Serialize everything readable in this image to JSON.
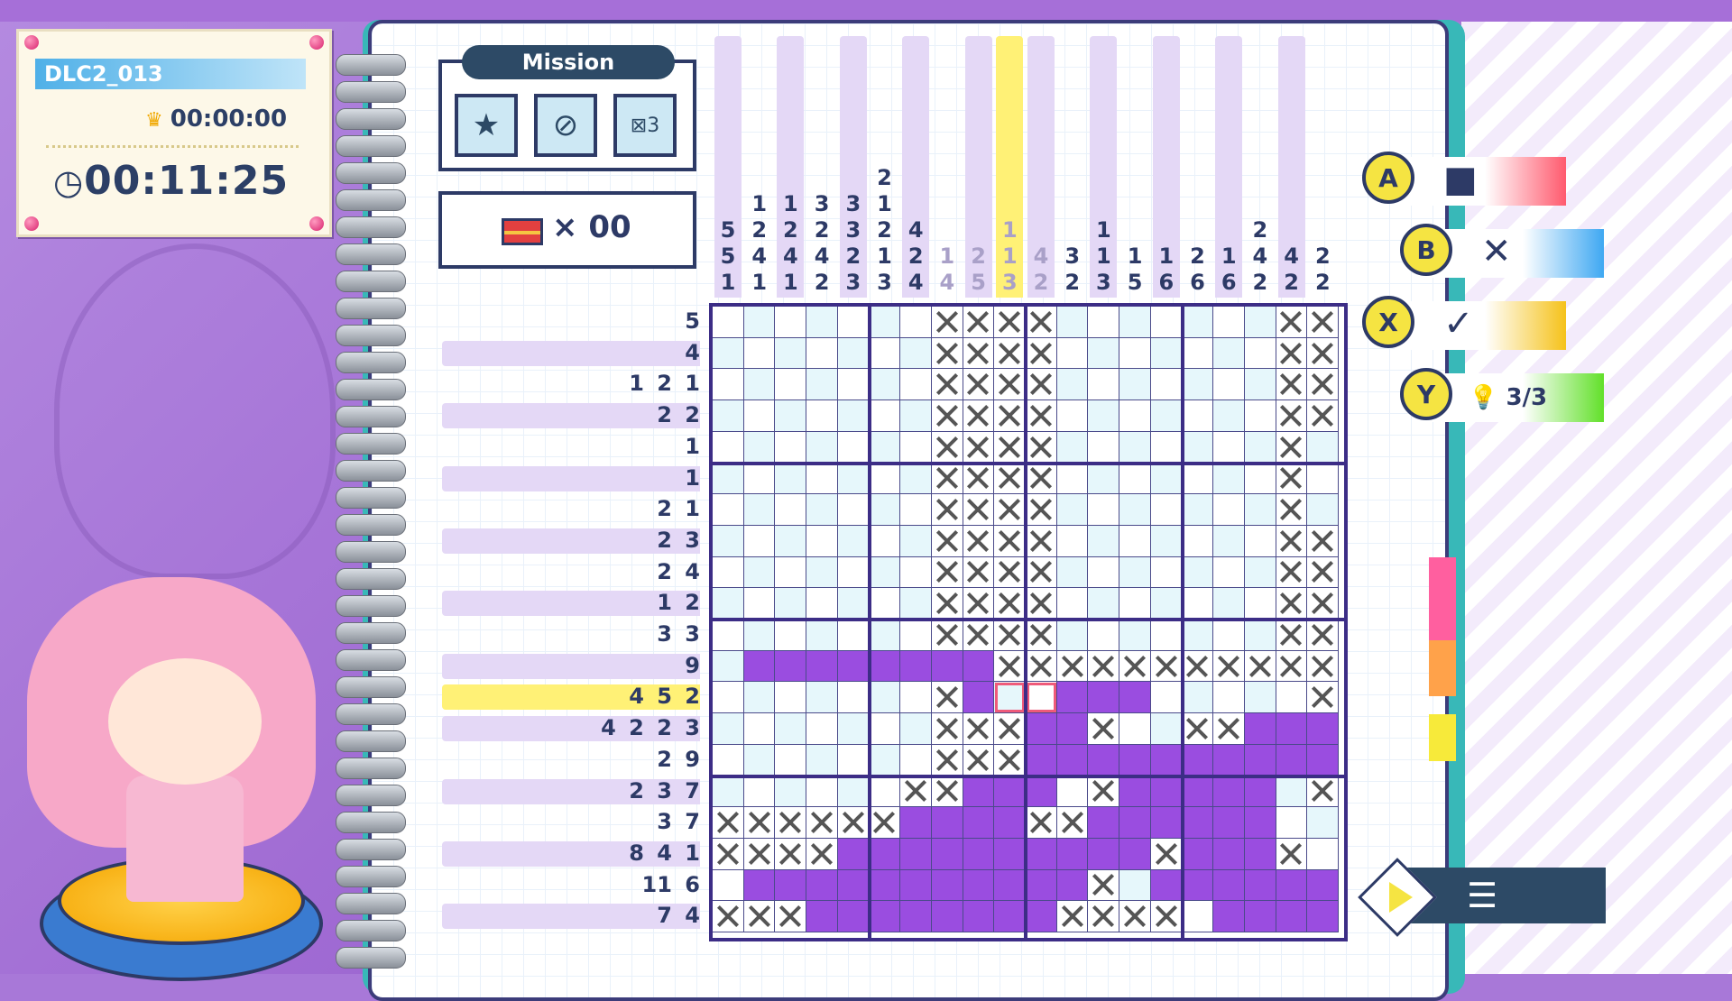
{
  "info": {
    "puzzle_id": "DLC2_013",
    "best_time": "00:00:00",
    "elapsed_time": "00:11:25"
  },
  "mission": {
    "label": "Mission",
    "icons": [
      "star-badge-icon",
      "no-hint-icon",
      "mistake-limit-icon"
    ],
    "mistake_limit": "3"
  },
  "treasure": {
    "times": "×",
    "count": "00"
  },
  "controls": {
    "a": {
      "button": "A",
      "action": "fill-square-icon",
      "symbol": "■",
      "color": "#ff5a6e"
    },
    "b": {
      "button": "B",
      "action": "cross-icon",
      "symbol": "✕",
      "color": "#3fa8f2"
    },
    "x": {
      "button": "X",
      "action": "check-icon",
      "symbol": "✓",
      "color": "#f5c21a"
    },
    "y": {
      "button": "Y",
      "action": "hint-bulb-icon",
      "hints": "3/3",
      "color": "#62e02a"
    }
  },
  "colors": {
    "fill": "#9a4de0",
    "highlight": "#fff176",
    "grid": "#3c2d86"
  },
  "highlight": {
    "row": 12,
    "col": 9
  },
  "cursor": {
    "row": 12,
    "col": 9
  },
  "column_clues": [
    {
      "nums": [
        "5",
        "5",
        "1"
      ],
      "done": false
    },
    {
      "nums": [
        "1",
        "2",
        "4",
        "1"
      ],
      "done": false
    },
    {
      "nums": [
        "1",
        "2",
        "4",
        "1"
      ],
      "done": false
    },
    {
      "nums": [
        "3",
        "2",
        "4",
        "2"
      ],
      "done": false
    },
    {
      "nums": [
        "3",
        "3",
        "2",
        "3"
      ],
      "done": false
    },
    {
      "nums": [
        "2",
        "1",
        "2",
        "1",
        "3"
      ],
      "done": false
    },
    {
      "nums": [
        "4",
        "2",
        "4"
      ],
      "done": false
    },
    {
      "nums": [
        "1",
        "4"
      ],
      "done": true
    },
    {
      "nums": [
        "2",
        "5"
      ],
      "done": true
    },
    {
      "nums": [
        "1",
        "1",
        "3"
      ],
      "done": true
    },
    {
      "nums": [
        "4",
        "2"
      ],
      "done": true
    },
    {
      "nums": [
        "3",
        "2"
      ],
      "done": false
    },
    {
      "nums": [
        "1",
        "1",
        "3"
      ],
      "done": false
    },
    {
      "nums": [
        "1",
        "5"
      ],
      "done": false
    },
    {
      "nums": [
        "1",
        "6"
      ],
      "done": false
    },
    {
      "nums": [
        "2",
        "6"
      ],
      "done": false
    },
    {
      "nums": [
        "1",
        "6"
      ],
      "done": false
    },
    {
      "nums": [
        "2",
        "4",
        "2"
      ],
      "done": false
    },
    {
      "nums": [
        "4",
        "2"
      ],
      "done": false
    },
    {
      "nums": [
        "2",
        "2"
      ],
      "done": false
    }
  ],
  "row_clues": [
    "5",
    "4",
    "1 2 1",
    "2 2",
    "1",
    "1",
    "2 1",
    "2 3",
    "2 4",
    "1 2",
    "3 3",
    "9",
    "4 5 2",
    "4 2 2 3",
    "2 9",
    "2 3 7",
    "3 7",
    "8 4 1",
    "11 6",
    "7 4"
  ],
  "grid": [
    "eeeeeeexxxxeeeeeeexx",
    "eeeeeeexxxxeeeeeeexx",
    "eeeeeeexxxxeeeeeeexx",
    "eeeeeeexxxxeeeeeeexx",
    "eeeeeeexxxxeeeeeeexe",
    "eeeeeeexxxxeeeeeeexe",
    "eeeeeeexxxxeeeeeeexe",
    "eeeeeeexxxxeeeeeeexx",
    "eeeeeeexxxxeeeeeeexx",
    "eeeeeeexxxxeeeeeeexx",
    "eeeeeeexxxxeeeeeeexx",
    "effffffffxxxxxxxxxxx",
    "eeeeeeexfecfffeeeeex",
    "eeeeeeexxxffxeexxfff",
    "eeeeeeexxxffffffffff",
    "eeeeeexxfffexfffffex",
    "xxxxxxffffxxffffffee",
    "xxxxffffffffffxfffxe",
    "efffffffffffxeffffff",
    "xxxffffffffxxxxeffff"
  ]
}
